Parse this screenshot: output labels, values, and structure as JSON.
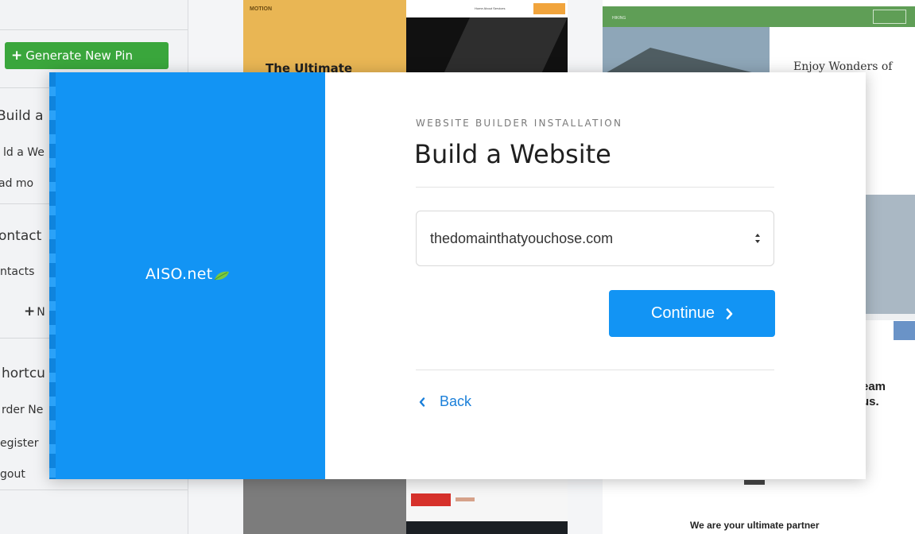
{
  "background": {
    "sidebar": {
      "generate_button": "Generate New Pin",
      "items": [
        {
          "text": "Build a",
          "kind": "head"
        },
        {
          "text": "ld a We",
          "kind": "item"
        },
        {
          "text": "ad mo",
          "kind": "item"
        },
        {
          "text": "ontact",
          "kind": "head"
        },
        {
          "text": "ntacts",
          "kind": "item"
        },
        {
          "text": "hortcu",
          "kind": "head"
        },
        {
          "text": "rder Ne",
          "kind": "item"
        },
        {
          "text": "egister",
          "kind": "item"
        },
        {
          "text": "gout",
          "kind": "item"
        }
      ],
      "new_label": "N"
    },
    "templates": {
      "motion_logo": "MOTION",
      "motion_title": "The Ultimate",
      "dark_nav": "Home About Services",
      "hiking_brand": "HIKING",
      "hiking_heading": "Enjoy Wonders of",
      "team_text_line1": "eam",
      "team_text_line2": "us.",
      "partner_text": "We are your ultimate partner"
    }
  },
  "modal": {
    "brand": {
      "logo_text": "AISO.net",
      "accent_color": "#7ac943"
    },
    "left_color": "#1294f4",
    "eyebrow": "WEBSITE BUILDER INSTALLATION",
    "title": "Build a Website",
    "domain_select": {
      "selected": "thedomainthatyouchose.com"
    },
    "continue_label": "Continue",
    "back_label": "Back"
  }
}
